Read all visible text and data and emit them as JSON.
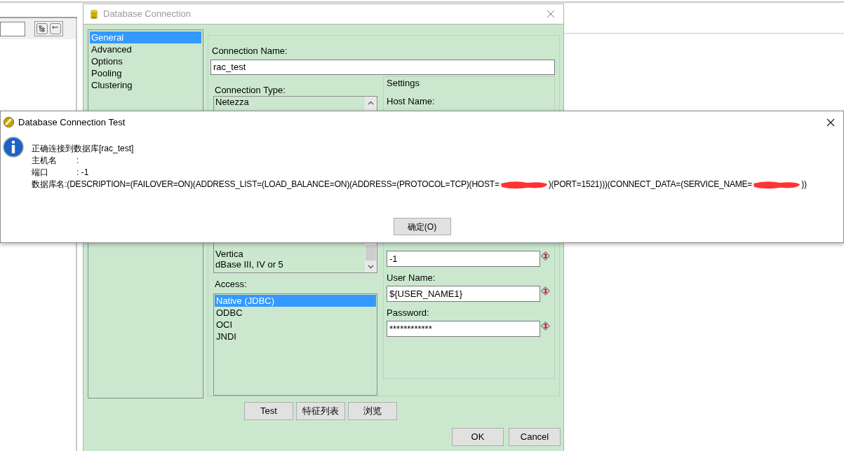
{
  "connection_dialog": {
    "title": "Database Connection",
    "categories": [
      {
        "label": "General",
        "selected": true
      },
      {
        "label": "Advanced",
        "selected": false
      },
      {
        "label": "Options",
        "selected": false
      },
      {
        "label": "Pooling",
        "selected": false
      },
      {
        "label": "Clustering",
        "selected": false
      }
    ],
    "connection_name": {
      "label": "Connection Name:",
      "value": "rac_test"
    },
    "connection_type": {
      "label": "Connection Type:",
      "top_items": [
        "Netezza"
      ],
      "bottom_items": [
        "Vertica",
        "dBase III, IV or 5"
      ]
    },
    "access": {
      "label": "Access:",
      "items": [
        {
          "label": "Native (JDBC)",
          "selected": true
        },
        {
          "label": "ODBC",
          "selected": false
        },
        {
          "label": "OCI",
          "selected": false
        },
        {
          "label": "JNDI",
          "selected": false
        }
      ]
    },
    "settings": {
      "title": "Settings",
      "host_label": "Host Name:",
      "port_value": "-1",
      "user_label": "User Name:",
      "user_value": "${USER_NAME1}",
      "password_label": "Password:",
      "password_value": "************"
    },
    "action_buttons": [
      "Test",
      "特征列表",
      "浏览"
    ],
    "buttons": [
      "OK",
      "Cancel"
    ]
  },
  "test_dialog": {
    "title": "Database Connection Test",
    "heading": "正确连接到数据库[rac_test]",
    "fields": [
      {
        "label": "主机名",
        "value": ":"
      },
      {
        "label": "端口",
        "value": ": -1"
      }
    ],
    "db_line": [
      {
        "kind": "text",
        "text": "数据库名:(DESCRIPTION=(FAILOVER=ON)(ADDRESS_LIST=(LOAD_BALANCE=ON)(ADDRESS=(PROTOCOL=TCP)(HOST="
      },
      {
        "kind": "redacted"
      },
      {
        "kind": "text",
        "text": ")(PORT=1521)))(CONNECT_DATA=(SERVICE_NAME="
      },
      {
        "kind": "redacted"
      },
      {
        "kind": "text",
        "text": "))"
      }
    ],
    "button": "确定(O)"
  }
}
